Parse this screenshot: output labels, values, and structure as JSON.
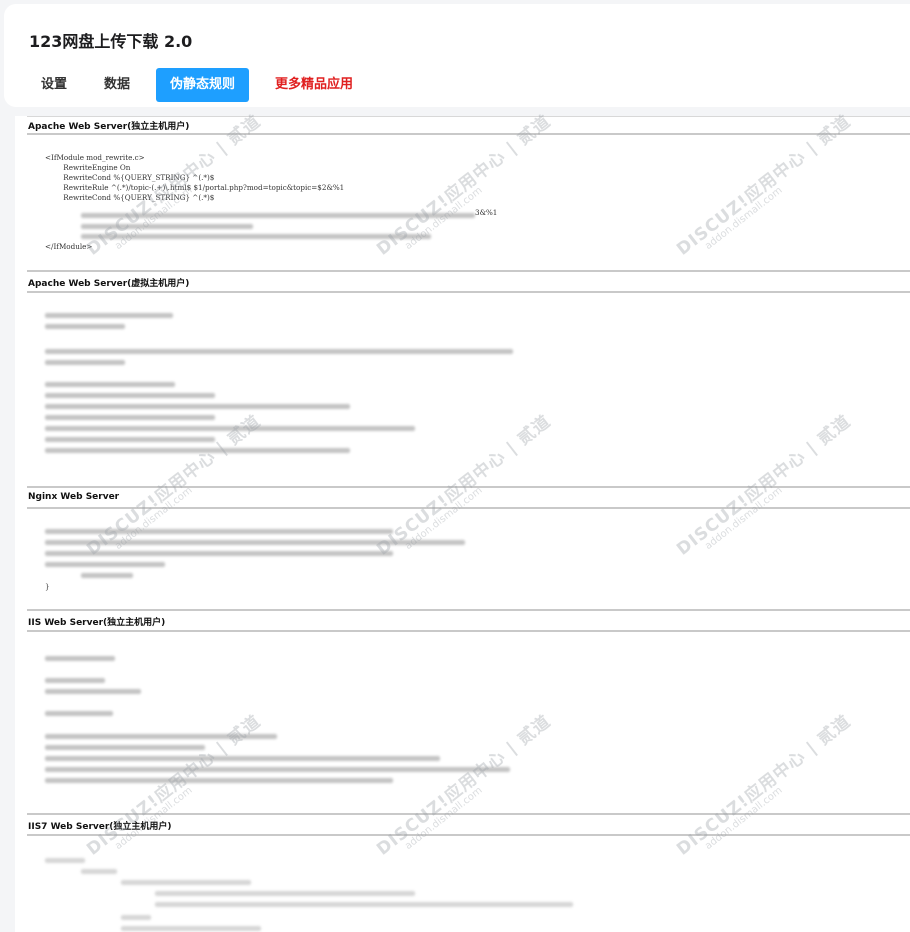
{
  "app": {
    "title": "123网盘上传下载 2.0"
  },
  "tabs": [
    {
      "label": "设置"
    },
    {
      "label": "数据"
    },
    {
      "label": "伪静态规则"
    },
    {
      "label": "更多精品应用"
    }
  ],
  "sections": [
    {
      "title": "Apache Web Server(独立主机用户)"
    },
    {
      "title": "Apache Web Server(虚拟主机用户)"
    },
    {
      "title": "Nginx Web Server"
    },
    {
      "title": "IIS Web Server(独立主机用户)"
    },
    {
      "title": "IIS7 Web Server(独立主机用户)"
    }
  ],
  "apache_code": {
    "line1": "<IfModule mod_rewrite.c>",
    "line2": "        RewriteEngine On",
    "line3": "        RewriteCond %{QUERY_STRING} ^(.*)$",
    "line4": "        RewriteRule ^(.*)/topic-(.+)\\.html$ $1/portal.php?mod=topic&topic=$2&%1",
    "line5": "        RewriteCond %{QUERY_STRING} ^(.*)$",
    "line6_tail": "3&%1",
    "line_end": "</IfModule>"
  },
  "nginx_code": {
    "closing": "}"
  },
  "watermark": {
    "main": "DISCUZ!应用中心 | 贰道",
    "sub": "addon.dismall.com"
  }
}
